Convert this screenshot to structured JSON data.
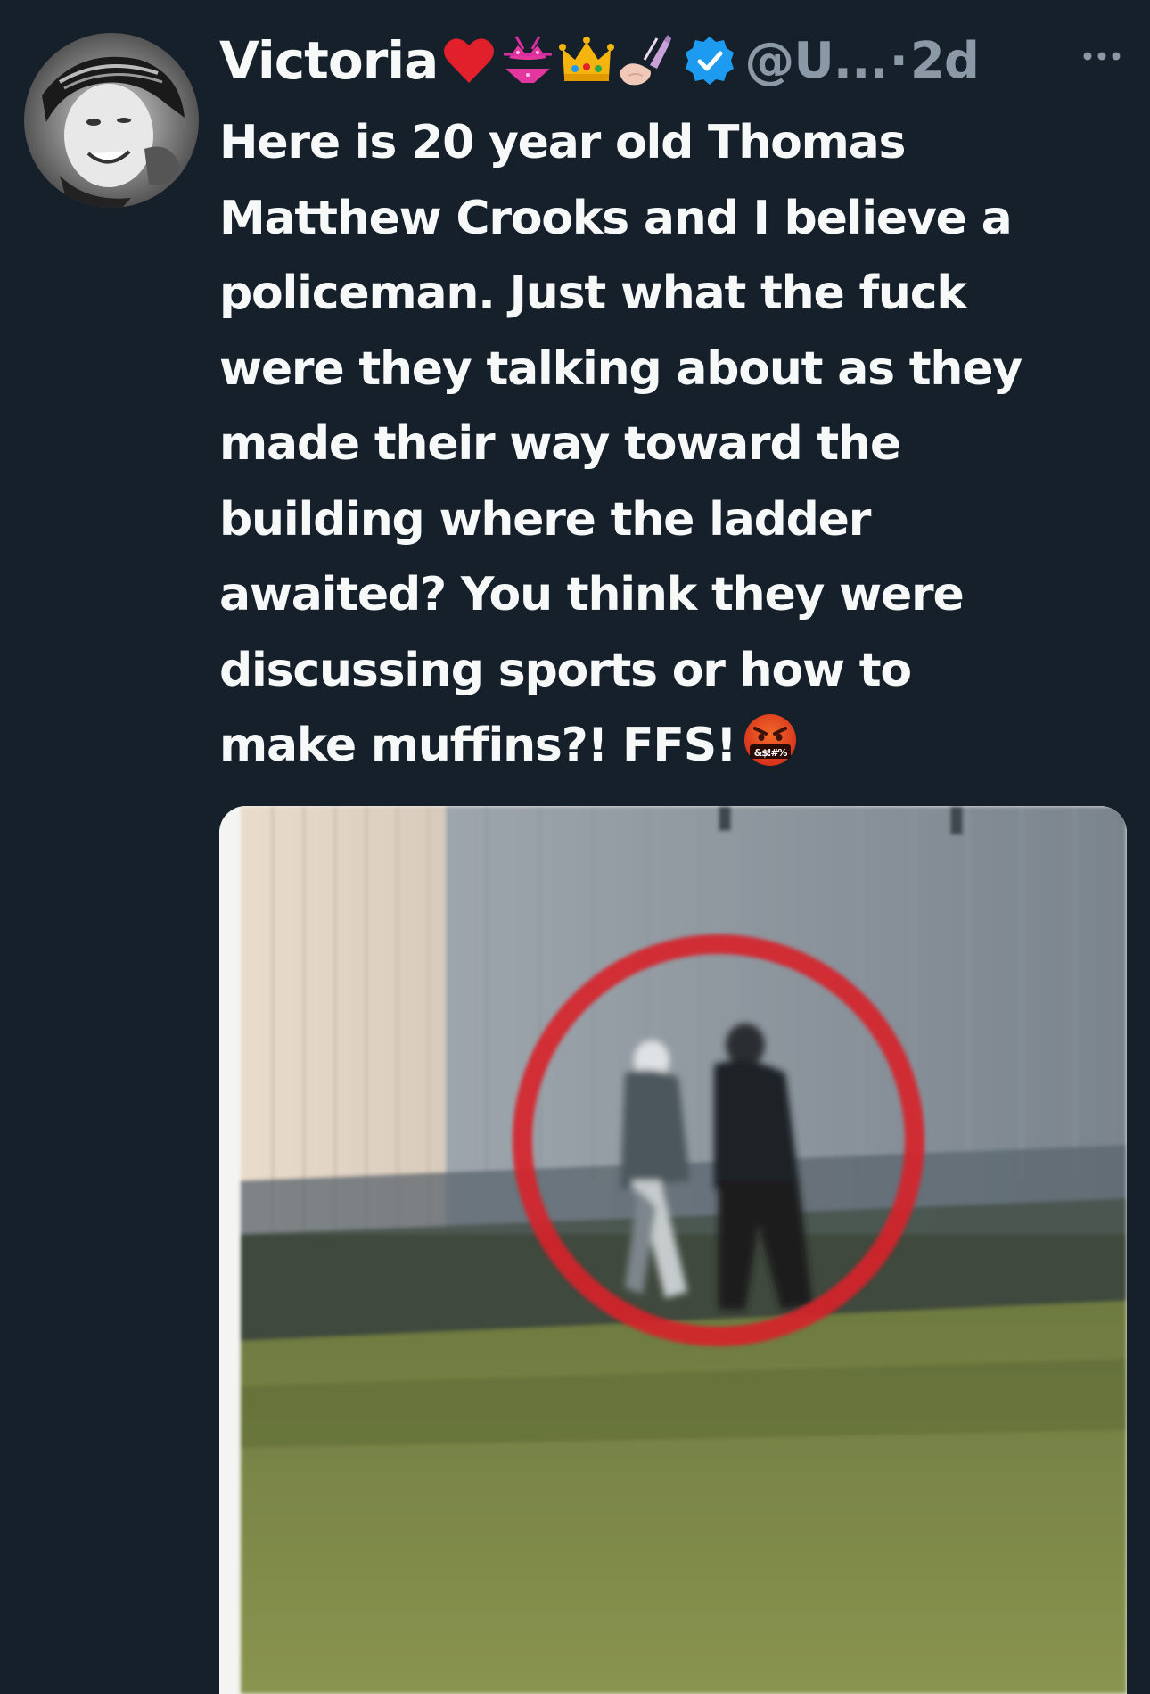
{
  "tweet": {
    "author": {
      "display_name": "Victoria",
      "name_emojis": [
        "red-heart-icon",
        "bikini-icon",
        "crown-icon",
        "nail-polish-icon"
      ],
      "verified": true,
      "handle": "@U...",
      "avatar_icon": "avatar"
    },
    "separator": "·",
    "timestamp": "2d",
    "text_lines": [
      "Here is 20 year old Thomas",
      "Matthew Crooks and I believe a",
      "policeman.  Just what the fuck",
      "were they talking about as they",
      "made their way toward the",
      "building where the ladder",
      "awaited? You think they were",
      "discussing sports or how to",
      "make muffins?! FFS!"
    ],
    "trailing_emoji": "face-with-symbols-on-mouth-icon",
    "trailing_emoji_text": "&$!#%",
    "media": {
      "description_icon": "photo-two-people-circled",
      "highlight_color": "#d8222a"
    }
  },
  "colors": {
    "background": "#15202b",
    "text_primary": "#f7f9f9",
    "text_secondary": "#8b98a5",
    "verified_blue": "#1d9bf0"
  }
}
